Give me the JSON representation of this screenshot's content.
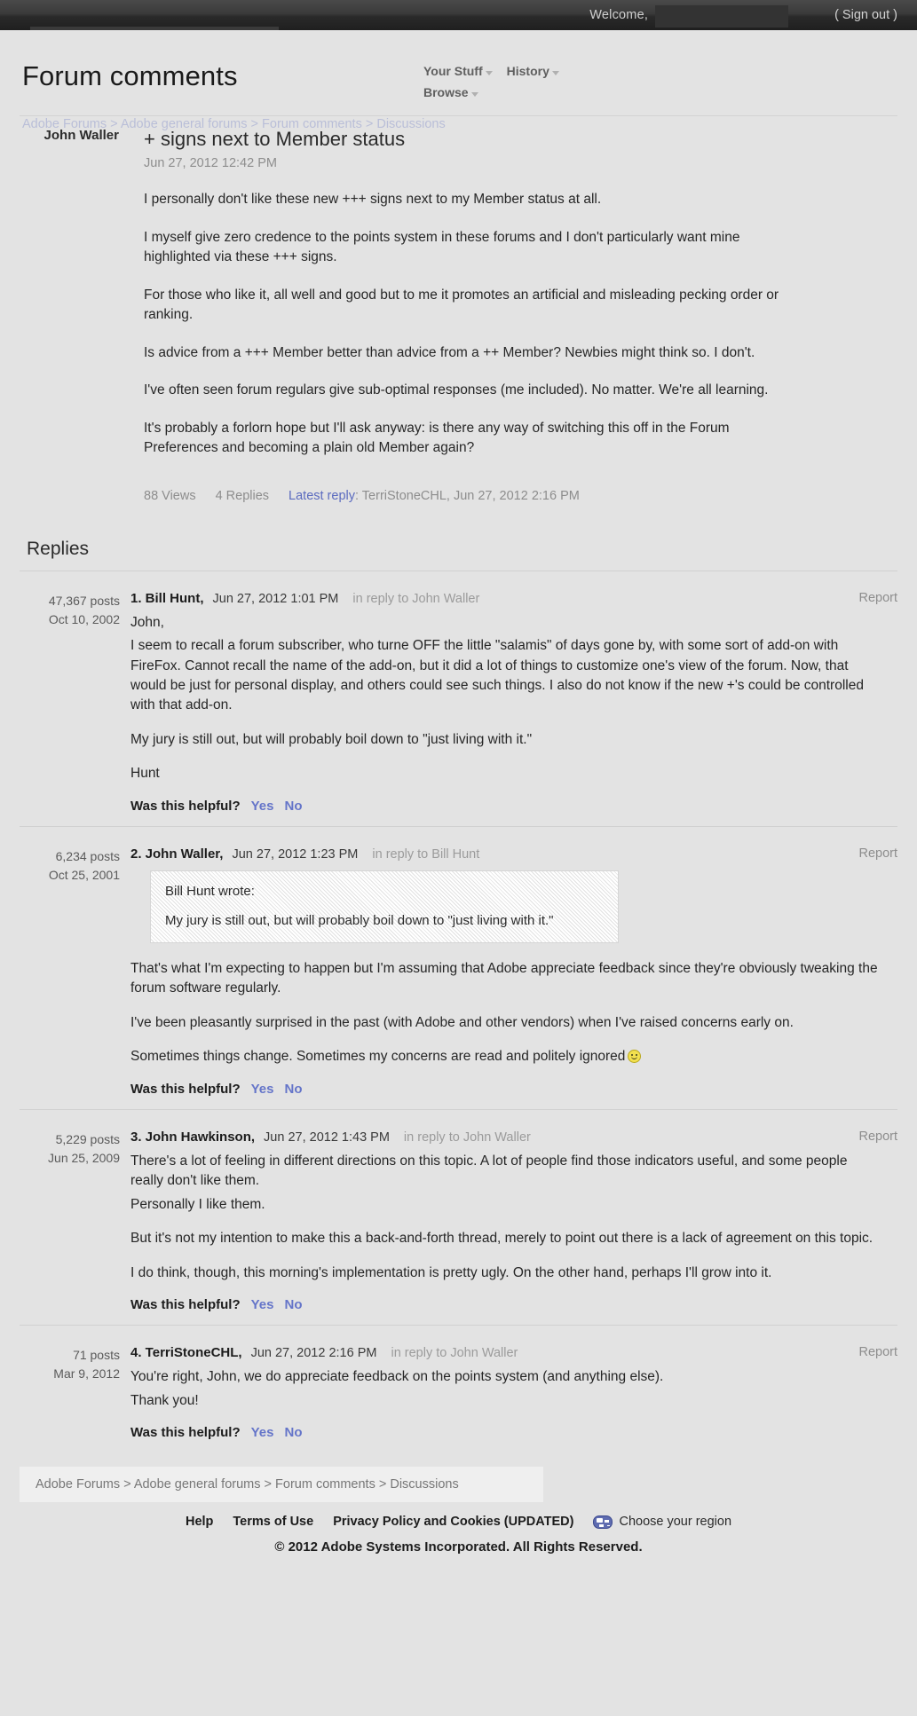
{
  "topbar": {
    "welcome_label": "Welcome,",
    "username_redacted": "",
    "sign_out_label": "( Sign out )"
  },
  "header": {
    "page_title": "Forum comments",
    "breadcrumb": "Adobe Forums  >  Adobe general forums  >  Forum comments  >  Discussions",
    "nav": [
      {
        "label": "Your Stuff",
        "icon": "chevron-down-icon"
      },
      {
        "label": "History",
        "icon": "chevron-down-icon"
      },
      {
        "label": "Browse",
        "icon": "chevron-down-icon"
      }
    ]
  },
  "main_post": {
    "author": "John Waller",
    "title": "+ signs next to Member status",
    "date": "Jun 27, 2012 12:42 PM",
    "paragraphs": [
      "I personally don't like these new +++ signs next to my Member status at all.",
      "I myself give zero credence to the points system in these forums and I don't particularly want mine highlighted via these +++ signs.",
      "For those who like it, all well and good but to me it promotes an artificial and misleading pecking order or ranking.",
      "Is advice from a +++ Member better than advice from a ++ Member? Newbies might think so. I don't.",
      "I've often seen forum regulars give sub-optimal responses (me included). No matter. We're all learning.",
      "It's probably a forlorn hope but I'll ask anyway: is there any way of switching this off in the Forum Preferences and becoming a plain old Member again?"
    ],
    "views": "88 Views",
    "replies_count": "4 Replies",
    "latest_reply_label": "Latest reply",
    "latest_reply_value": ": TerriStoneCHL, Jun 27, 2012 2:16 PM"
  },
  "replies_section": {
    "heading": "Replies",
    "helpful_label": "Was this helpful?",
    "yes_label": "Yes",
    "no_label": "No",
    "report_label": "Report",
    "items": [
      {
        "posts": "47,367 posts",
        "member_since": "Oct 10, 2002",
        "index_name": "1. Bill Hunt,",
        "when": "Jun 27, 2012  1:01 PM",
        "in_reply_to": "in reply to John Waller",
        "paragraphs": [
          "John,",
          "I seem to recall a forum subscriber, who turne OFF the little \"salamis\" of days gone by, with some sort of add-on with FireFox. Cannot recall the name of the add-on, but it did a lot of things to customize one's view of the forum. Now, that would be just for personal display, and others could see such things. I also do not know if the new +'s could be controlled with that add-on.",
          "My jury is still out, but will probably boil down to \"just living with it.\"",
          "Hunt"
        ]
      },
      {
        "posts": "6,234 posts",
        "member_since": "Oct 25, 2001",
        "index_name": "2. John Waller,",
        "when": "Jun 27, 2012  1:23 PM",
        "in_reply_to": "in reply to Bill Hunt",
        "quote_author": "Bill Hunt wrote:",
        "quote_text": "My jury is still out, but will probably boil down to \"just living with it.\"",
        "paragraphs": [
          "That's what I'm expecting to happen but I'm assuming that Adobe appreciate feedback since they're obviously tweaking the forum software regularly.",
          "I've been pleasantly surprised in the past (with Adobe and other vendors) when I've raised concerns early on.",
          "Sometimes things change. Sometimes my concerns are read and politely ignored"
        ]
      },
      {
        "posts": "5,229 posts",
        "member_since": "Jun 25, 2009",
        "index_name": "3. John Hawkinson,",
        "when": "Jun 27, 2012  1:43 PM",
        "in_reply_to": "in reply to John Waller",
        "paragraphs": [
          "There's a lot of feeling in different directions on this topic. A lot of people find those indicators useful, and some people really don't like them.",
          "Personally I like them.",
          "But it's not my intention to make this a back-and-forth thread, merely to point out there is a lack of agreement on this topic.",
          "I do think, though, this morning's implementation is pretty ugly. On the other hand, perhaps I'll grow into it."
        ]
      },
      {
        "posts": "71 posts",
        "member_since": "Mar 9, 2012",
        "index_name": "4. TerriStoneCHL,",
        "when": "Jun 27, 2012  2:16 PM",
        "in_reply_to": "in reply to John Waller",
        "paragraphs": [
          "You're right, John, we do appreciate feedback on the points system (and anything else).",
          "Thank you!"
        ]
      }
    ]
  },
  "footer": {
    "breadcrumb": "Adobe Forums  >  Adobe general forums  >  Forum comments  >  Discussions",
    "links": [
      "Help",
      "Terms of Use",
      "Privacy Policy and Cookies (UPDATED)"
    ],
    "region_label": "Choose your region",
    "copyright": "© 2012 Adobe Systems Incorporated. All Rights Reserved."
  },
  "colors": {
    "link_blue": "#5b6bbf",
    "vote_blue": "#6575c9",
    "page_bg": "#e3e3e3",
    "topbar_dark": "#2a2a2a"
  }
}
